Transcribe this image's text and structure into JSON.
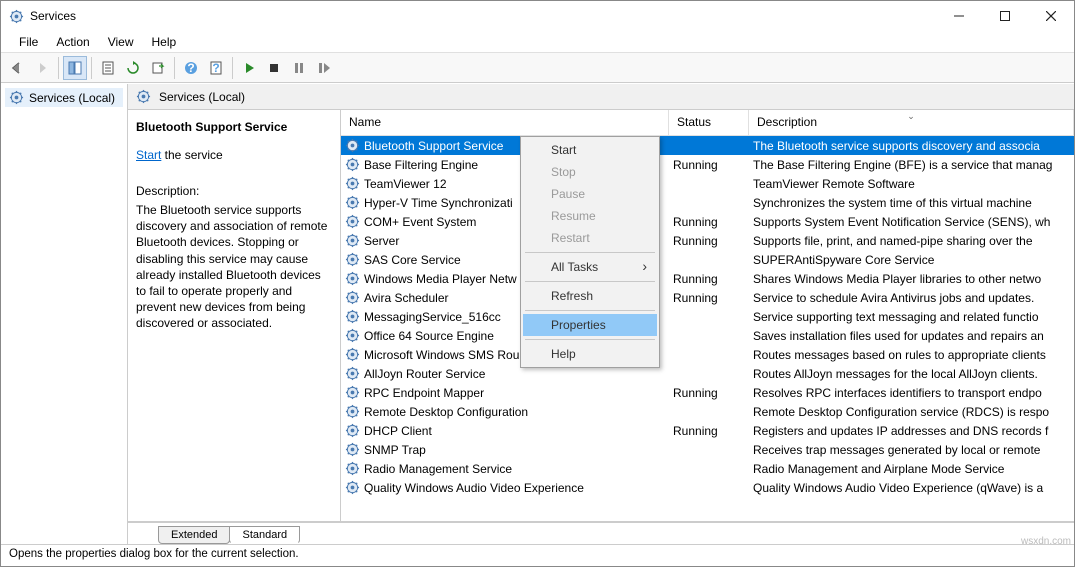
{
  "window": {
    "title": "Services"
  },
  "menus": [
    "File",
    "Action",
    "View",
    "Help"
  ],
  "nav": {
    "item": "Services (Local)"
  },
  "header": {
    "title": "Services (Local)"
  },
  "detail": {
    "name": "Bluetooth Support Service",
    "start_link": "Start",
    "start_suffix": " the service",
    "desc_label": "Description:",
    "desc": "The Bluetooth service supports discovery and association of remote Bluetooth devices.  Stopping or disabling this service may cause already installed Bluetooth devices to fail to operate properly and prevent new devices from being discovered or associated."
  },
  "columns": {
    "name": "Name",
    "status": "Status",
    "desc": "Description"
  },
  "services": [
    {
      "name": "Bluetooth Support Service",
      "status": "",
      "desc": "The Bluetooth service supports discovery and associa",
      "sel": true
    },
    {
      "name": "Base Filtering Engine",
      "status": "Running",
      "desc": "The Base Filtering Engine (BFE) is a service that manag"
    },
    {
      "name": "TeamViewer 12",
      "status": "",
      "desc": "TeamViewer Remote Software"
    },
    {
      "name": "Hyper-V Time Synchronizati",
      "status": "",
      "desc": "Synchronizes the system time of this virtual machine"
    },
    {
      "name": "COM+ Event System",
      "status": "Running",
      "desc": "Supports System Event Notification Service (SENS), wh"
    },
    {
      "name": "Server",
      "status": "Running",
      "desc": "Supports file, print, and named-pipe sharing over the"
    },
    {
      "name": "SAS Core Service",
      "status": "",
      "desc": "SUPERAntiSpyware Core Service"
    },
    {
      "name": "Windows Media Player Netw",
      "status": "Running",
      "desc": "Shares Windows Media Player libraries to other netwo"
    },
    {
      "name": "Avira Scheduler",
      "status": "Running",
      "desc": "Service to schedule Avira Antivirus jobs and updates."
    },
    {
      "name": "MessagingService_516cc",
      "status": "",
      "desc": "Service supporting text messaging and related functio"
    },
    {
      "name": "Office 64 Source Engine",
      "status": "",
      "desc": "Saves installation files used for updates and repairs an"
    },
    {
      "name": "Microsoft Windows SMS Rou",
      "status": "",
      "desc": "Routes messages based on rules to appropriate clients"
    },
    {
      "name": "AllJoyn Router Service",
      "status": "",
      "desc": "Routes AllJoyn messages for the local AllJoyn clients."
    },
    {
      "name": "RPC Endpoint Mapper",
      "status": "Running",
      "desc": "Resolves RPC interfaces identifiers to transport endpo"
    },
    {
      "name": "Remote Desktop Configuration",
      "status": "",
      "desc": "Remote Desktop Configuration service (RDCS) is respo"
    },
    {
      "name": "DHCP Client",
      "status": "Running",
      "desc": "Registers and updates IP addresses and DNS records f"
    },
    {
      "name": "SNMP Trap",
      "status": "",
      "desc": "Receives trap messages generated by local or remote"
    },
    {
      "name": "Radio Management Service",
      "status": "",
      "desc": "Radio Management and Airplane Mode Service"
    },
    {
      "name": "Quality Windows Audio Video Experience",
      "status": "",
      "desc": "Quality Windows Audio Video Experience (qWave) is a"
    }
  ],
  "context": {
    "items": [
      {
        "label": "Start",
        "enabled": true
      },
      {
        "label": "Stop",
        "enabled": false
      },
      {
        "label": "Pause",
        "enabled": false
      },
      {
        "label": "Resume",
        "enabled": false
      },
      {
        "label": "Restart",
        "enabled": false
      },
      {
        "sep": true
      },
      {
        "label": "All Tasks",
        "enabled": true,
        "sub": true
      },
      {
        "sep": true
      },
      {
        "label": "Refresh",
        "enabled": true
      },
      {
        "sep": true
      },
      {
        "label": "Properties",
        "enabled": true,
        "hl": true
      },
      {
        "sep": true
      },
      {
        "label": "Help",
        "enabled": true
      }
    ]
  },
  "tabs": {
    "extended": "Extended",
    "standard": "Standard"
  },
  "statusbar": "Opens the properties dialog box for the current selection.",
  "watermark": "wsxdn.com"
}
